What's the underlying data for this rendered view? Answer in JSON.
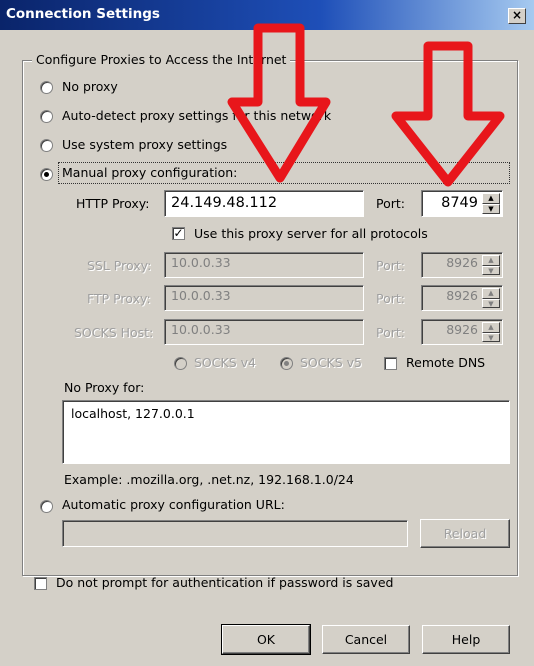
{
  "window": {
    "title": "Connection Settings",
    "close_glyph": "×"
  },
  "group": {
    "title": "Configure Proxies to Access the Internet"
  },
  "options": {
    "no_proxy": "No proxy",
    "auto_detect": "Auto-detect proxy settings for this network",
    "system": "Use system proxy settings",
    "manual": "Manual proxy configuration:",
    "auto_config": "Automatic proxy configuration URL:"
  },
  "manual": {
    "http_label": "HTTP Proxy:",
    "http_value": "24.149.48.112",
    "port_label": "Port:",
    "http_port": "8749",
    "same_proxy": "Use this proxy server for all protocols",
    "ssl_label": "SSL Proxy:",
    "ssl_value": "10.0.0.33",
    "ssl_port": "8926",
    "ftp_label": "FTP Proxy:",
    "ftp_value": "10.0.0.33",
    "ftp_port": "8926",
    "socks_label": "SOCKS Host:",
    "socks_value": "10.0.0.33",
    "socks_port": "8926",
    "socks_v4": "SOCKS v4",
    "socks_v5": "SOCKS v5",
    "remote_dns": "Remote DNS",
    "no_proxy_label": "No Proxy for:",
    "no_proxy_value": "localhost, 127.0.0.1",
    "example": "Example: .mozilla.org, .net.nz, 192.168.1.0/24"
  },
  "auto_url": {
    "value": "",
    "reload": "Reload"
  },
  "no_prompt": "Do not prompt for authentication if password is saved",
  "buttons": {
    "ok": "OK",
    "cancel": "Cancel",
    "help": "Help"
  },
  "colors": {
    "annotation_arrow": "#e8161b",
    "titlebar": "#0a246a"
  },
  "icons": {
    "spin_up": "▲",
    "spin_down": "▼",
    "check": "✓"
  }
}
